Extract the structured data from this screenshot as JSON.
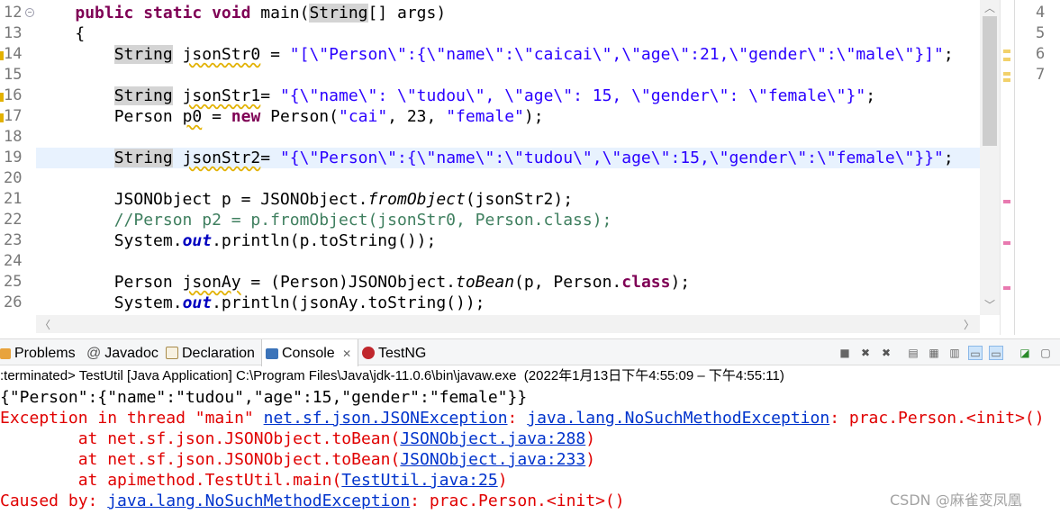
{
  "editor": {
    "line_numbers": [
      "12",
      "13",
      "14",
      "15",
      "16",
      "17",
      "18",
      "19",
      "20",
      "21",
      "22",
      "23",
      "24",
      "25",
      "26"
    ],
    "lines": [
      {
        "type": "sig",
        "kw1": "public static void",
        "name": " main(",
        "hl": "String",
        "rest": "[] args)"
      },
      {
        "type": "plain",
        "text": "    {"
      },
      {
        "type": "decl",
        "indent": "        ",
        "typ": "String",
        "var": "jsonStr0",
        "eq": " = ",
        "str": "\"[\\\"Person\\\":{\\\"name\\\":\\\"caicai\\\",\\\"age\\\":21,\\\"gender\\\":\\\"male\\\"}]\"",
        "end": ";"
      },
      {
        "type": "plain",
        "text": ""
      },
      {
        "type": "decl",
        "indent": "        ",
        "typ": "String",
        "var": "jsonStr1",
        "eq": "= ",
        "str": "\"{\\\"name\\\": \\\"tudou\\\", \\\"age\\\": 15, \\\"gender\\\": \\\"female\\\"}\"",
        "end": ";"
      },
      {
        "type": "person",
        "pre": "        Person ",
        "var": "p0",
        "eq": " = ",
        "kw": "new",
        "mid": " Person(",
        "s1": "\"cai\"",
        "m2": ", 23, ",
        "s2": "\"female\"",
        "end": ");"
      },
      {
        "type": "plain",
        "text": ""
      },
      {
        "type": "decl",
        "indent": "        ",
        "typ": "String",
        "var": "jsonStr2",
        "eq": "= ",
        "str": "\"{\\\"Person\\\":{\\\"name\\\":\\\"tudou\\\",\\\"age\\\":15,\\\"gender\\\":\\\"female\\\"}}\"",
        "end": ";"
      },
      {
        "type": "plain",
        "text": ""
      },
      {
        "type": "call",
        "pre": "        JSONObject p = JSONObject.",
        "it": "fromObject",
        "post": "(jsonStr2);"
      },
      {
        "type": "comment",
        "text": "        //Person p2 = p.fromObject(jsonStr0, Person.class);"
      },
      {
        "type": "sysout",
        "pre": "        System.",
        "st": "out",
        "post": ".println(p.toString());"
      },
      {
        "type": "plain",
        "text": ""
      },
      {
        "type": "tobean",
        "pre": "        Person ",
        "var": "jsonAy",
        "mid": " = (Person)JSONObject.",
        "it": "toBean",
        "mid2": "(p, Person.",
        "kw": "class",
        "end": ");"
      },
      {
        "type": "sysout",
        "pre": "        System.",
        "st": "out",
        "post": ".println(jsonAy.toString());"
      }
    ],
    "side_line_numbers": [
      "4",
      "5",
      "6",
      "7"
    ]
  },
  "console": {
    "tabs": [
      {
        "label": "Problems",
        "icon": "problems-icon"
      },
      {
        "label": "Javadoc",
        "icon": "javadoc-icon"
      },
      {
        "label": "Declaration",
        "icon": "declaration-icon"
      },
      {
        "label": "Console",
        "icon": "console-icon",
        "close": "✕"
      },
      {
        "label": "TestNG",
        "icon": "testng-icon"
      }
    ],
    "status": ":terminated> TestUtil [Java Application] C:\\Program Files\\Java\\jdk-11.0.6\\bin\\javaw.exe  (2022年1月13日下午4:55:09 – 下午4:55:11)",
    "output_line": "{\"Person\":{\"name\":\"tudou\",\"age\":15,\"gender\":\"female\"}}",
    "exception": {
      "pre": "Exception in thread \"main\" ",
      "link1": "net.sf.json.JSONException",
      "sep": ": ",
      "link2": "java.lang.NoSuchMethodException",
      "post": ": prac.Person.<init>()"
    },
    "stack": [
      {
        "pre": "        at net.sf.json.JSONObject.toBean(",
        "link": "JSONObject.java:288",
        "post": ")"
      },
      {
        "pre": "        at net.sf.json.JSONObject.toBean(",
        "link": "JSONObject.java:233",
        "post": ")"
      },
      {
        "pre": "        at apimethod.TestUtil.main(",
        "link": "TestUtil.java:25",
        "post": ")"
      }
    ],
    "caused": {
      "pre": "Caused by: ",
      "link": "java.lang.NoSuchMethodException",
      "post": ": prac.Person.<init>()"
    }
  },
  "watermark": "CSDN @麻雀变凤凰",
  "colors": {
    "keyword": "#7f0055",
    "string": "#2a00ff",
    "error": "#e00000",
    "link": "#0033cc",
    "comment": "#3f7f5f"
  }
}
